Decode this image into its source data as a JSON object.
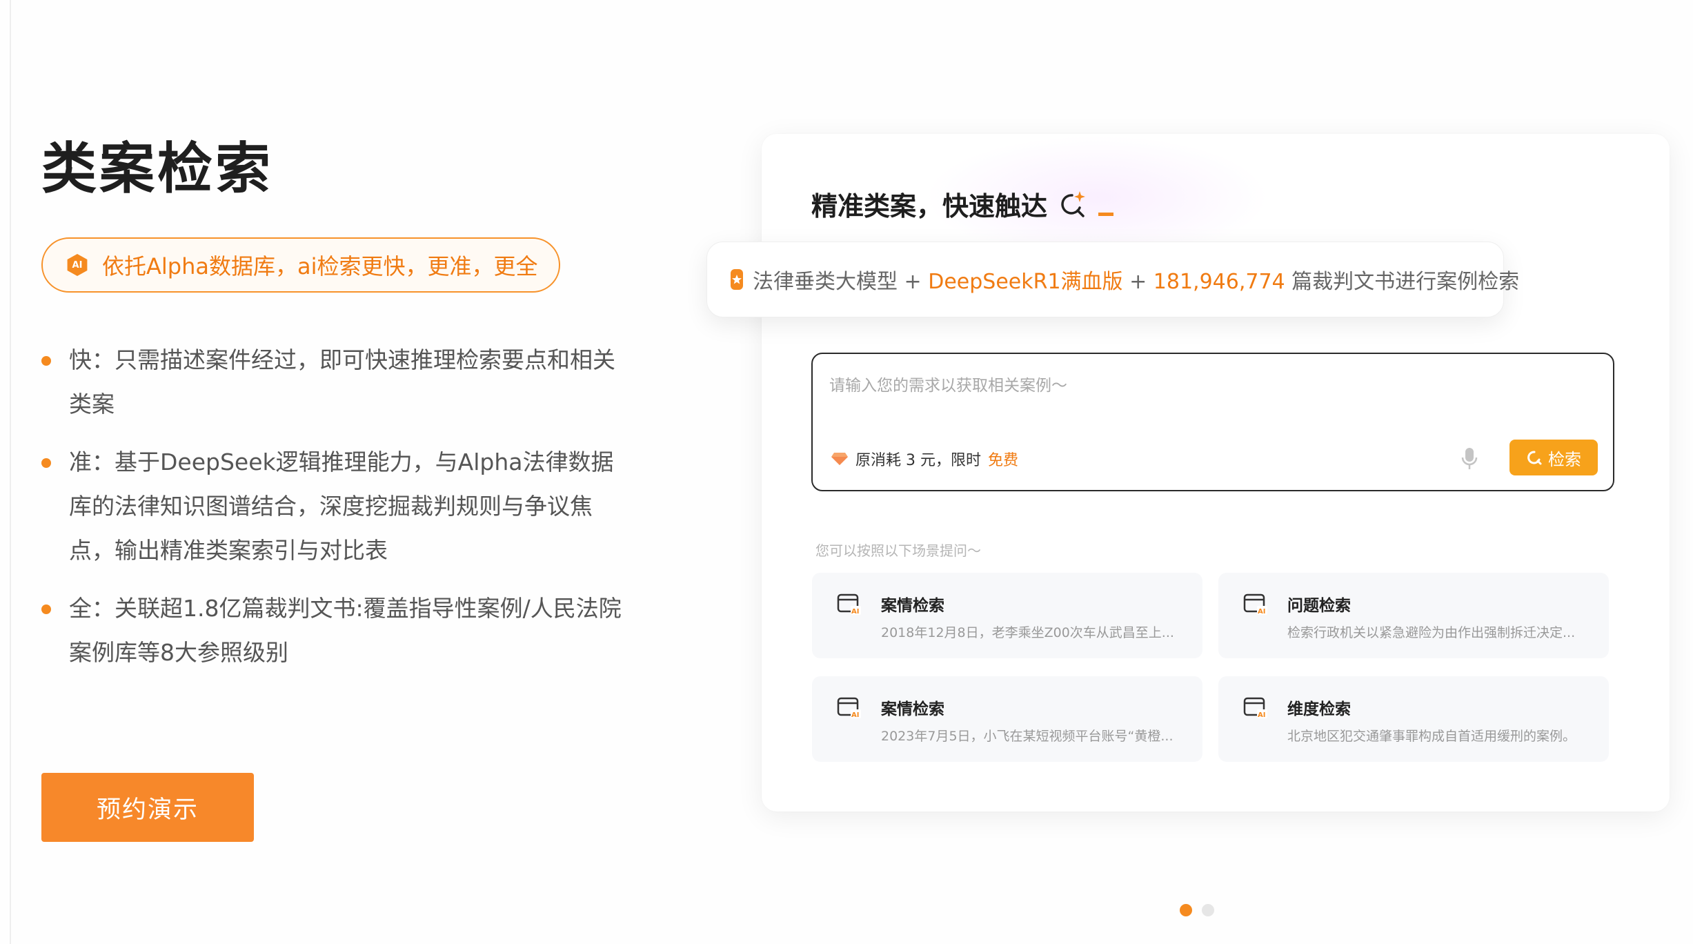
{
  "hero": {
    "title": "类案检索",
    "tagline": "依托Alpha数据库，ai检索更快，更准，更全",
    "ai_badge": "AI",
    "features": [
      "快：只需描述案件经过，即可快速推理检索要点和相关类案",
      "准：基于DeepSeek逻辑推理能力，与Alpha法律数据库的法律知识图谱结合，深度挖掘裁判规则与争议焦点，输出精准类案索引与对比表",
      "全：关联超1.8亿篇裁判文书:覆盖指导性案例/人民法院案例库等8大参照级别"
    ],
    "demo_button": "预约演示"
  },
  "card": {
    "title": "精准类案，快速触达",
    "banner": {
      "part1": "法律垂类大模型",
      "plus1": " + ",
      "part2": "DeepSeekR1满血版",
      "plus2": " + ",
      "part3": "181,946,774",
      "part4": " 篇裁判文书进行案例检索"
    },
    "search": {
      "placeholder": "请输入您的需求以获取相关案例～",
      "cost_prefix": "原消耗 3 元，限时",
      "cost_free": "免费",
      "button": "检索"
    },
    "hint": "您可以按照以下场景提问～",
    "scenarios": [
      {
        "title": "案情检索",
        "desc": "2018年12月8日，老李乘坐Z00次车从武昌至上..."
      },
      {
        "title": "问题检索",
        "desc": "检索行政机关以紧急避险为由作出强制拆迁决定..."
      },
      {
        "title": "案情检索",
        "desc": "2023年7月5日，小飞在某短视频平台账号“黄橙..."
      },
      {
        "title": "维度检索",
        "desc": "北京地区犯交通肇事罪构成自首适用缓刑的案例。"
      }
    ]
  },
  "carousel": {
    "count": 2,
    "active": 0
  },
  "colors": {
    "accent": "#f58a1f",
    "accent_text": "#f07b12",
    "button": "#f7882a",
    "search_button": "#f7a21b"
  }
}
